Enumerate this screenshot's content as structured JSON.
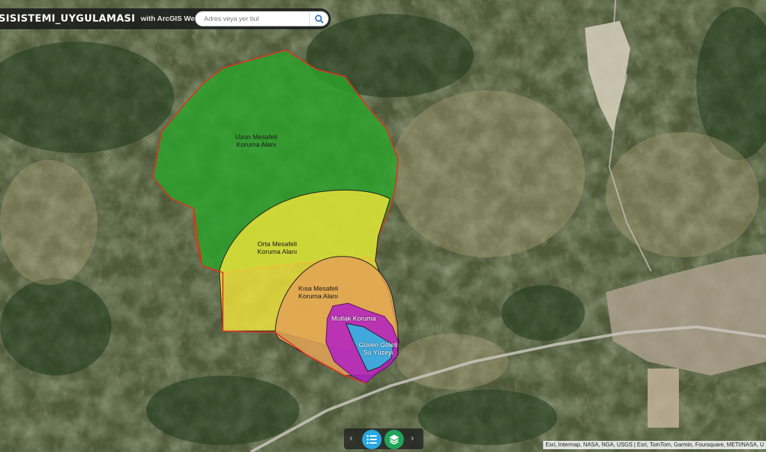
{
  "header": {
    "title": "SISISTEMI_UYGULAMASI",
    "subtitle": "with ArcGIS Web AppBuilder"
  },
  "search": {
    "placeholder": "Adres veya yer bul"
  },
  "map": {
    "zones": [
      {
        "name": "Uzun Mesafeli",
        "name2": "Koruma Alanı",
        "fill": "#29a529"
      },
      {
        "name": "Orta Mesafeli",
        "name2": "Koruma Alanı",
        "fill": "#f2e63a"
      },
      {
        "name": "Kısa Mesafeli",
        "name2": "Koruma Alanı",
        "fill": "#e3a255"
      },
      {
        "name": "Mutlak Koruma",
        "name2": "",
        "fill": "#b21fc4"
      },
      {
        "name": "Güven Göleti",
        "name2": "Su Yüzeyi",
        "fill": "#33b5e0"
      }
    ],
    "boundary_color": "#e03020"
  },
  "widgets": {
    "legend_icon": "list-icon",
    "layers_icon": "layers-icon",
    "prev_arrow": "‹",
    "next_arrow": "›"
  },
  "attribution": "Esri, Intermap, NASA, NGA, USGS | Esri, TomTom, Garmin, Foursquare, METI/NASA, U"
}
